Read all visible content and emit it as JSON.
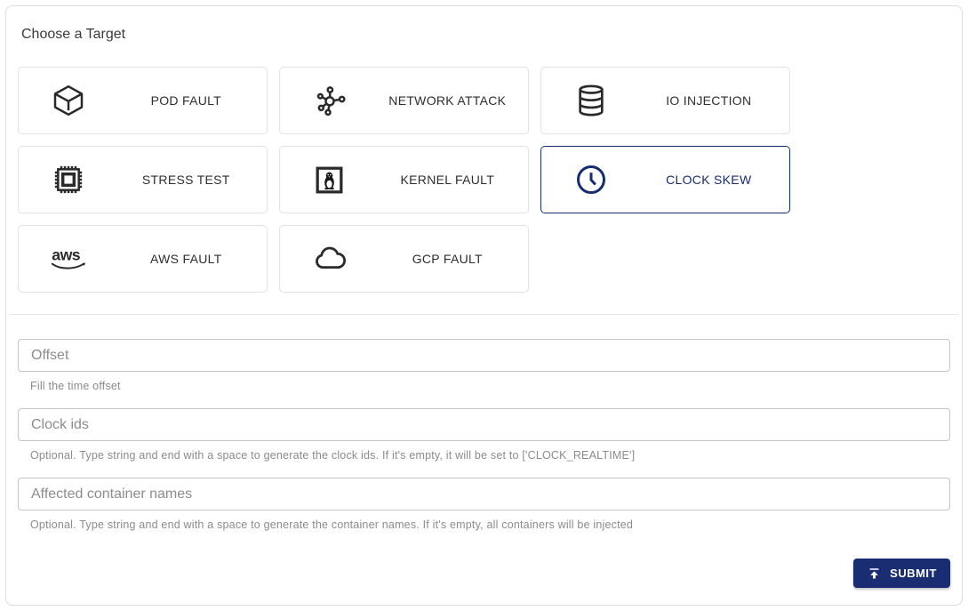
{
  "panel": {
    "title": "Choose a Target"
  },
  "targets": {
    "items": [
      {
        "label": "POD FAULT",
        "icon": "cube-icon",
        "selected": false
      },
      {
        "label": "NETWORK ATTACK",
        "icon": "network-icon",
        "selected": false
      },
      {
        "label": "IO INJECTION",
        "icon": "database-icon",
        "selected": false
      },
      {
        "label": "STRESS TEST",
        "icon": "chip-icon",
        "selected": false
      },
      {
        "label": "KERNEL FAULT",
        "icon": "penguin-icon",
        "selected": false
      },
      {
        "label": "CLOCK SKEW",
        "icon": "clock-icon",
        "selected": true
      },
      {
        "label": "AWS FAULT",
        "icon": "aws-logo-icon",
        "selected": false
      },
      {
        "label": "GCP FAULT",
        "icon": "cloud-icon",
        "selected": false
      }
    ]
  },
  "form": {
    "fields": [
      {
        "label": "Offset",
        "helper": "Fill the time offset"
      },
      {
        "label": "Clock ids",
        "helper": "Optional. Type string and end with a space to generate the clock ids. If it's empty, it will be set to ['CLOCK_REALTIME']"
      },
      {
        "label": "Affected container names",
        "helper": "Optional. Type string and end with a space to generate the container names. If it's empty, all containers will be injected"
      }
    ],
    "submit_label": "SUBMIT"
  },
  "colors": {
    "accent": "#172d72",
    "card_border": "#e2e2e2",
    "input_border": "#c6c6c6",
    "helper_text": "#8b8b8b",
    "submit_background": "#1a2d72"
  }
}
